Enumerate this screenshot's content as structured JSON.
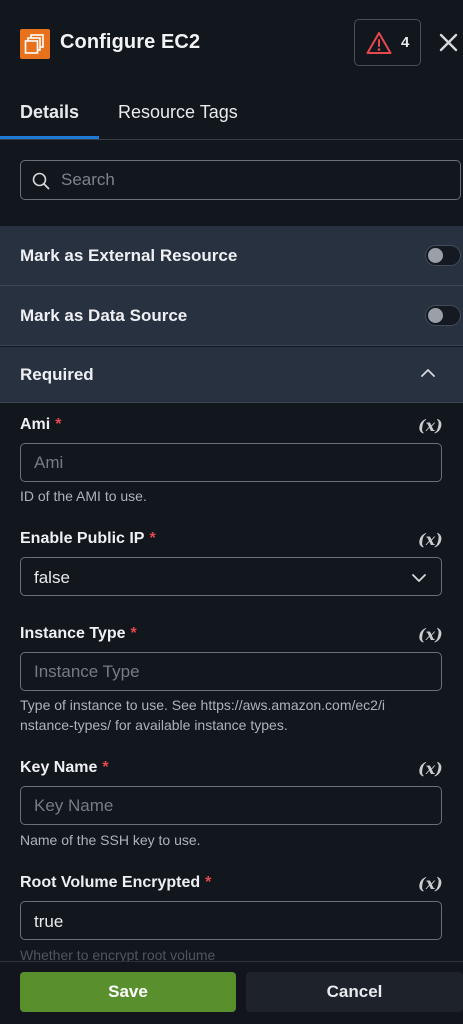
{
  "header": {
    "title": "Configure EC2",
    "app_icon": "aws-ec2-icon",
    "alert_count": "4",
    "alert_icon": "warning-triangle-icon",
    "close_icon": "close-icon",
    "accent_color": "#e8711c"
  },
  "tabs": [
    {
      "label": "Details",
      "active": true
    },
    {
      "label": "Resource Tags",
      "active": false
    }
  ],
  "search": {
    "placeholder": "Search",
    "value": ""
  },
  "toggles": [
    {
      "label": "Mark as External Resource",
      "on": false
    },
    {
      "label": "Mark as Data Source",
      "on": false
    }
  ],
  "section": {
    "label": "Required",
    "expanded": true
  },
  "variable_button": "(x)",
  "required_marker": "*",
  "fields": {
    "ami": {
      "label": "Ami",
      "placeholder": "Ami",
      "value": "",
      "help": "ID of the AMI to use."
    },
    "enable_public_ip": {
      "label": "Enable Public IP",
      "value": "false"
    },
    "instance_type": {
      "label": "Instance Type",
      "placeholder": "Instance Type",
      "value": "",
      "help_line1": "Type of instance to use. See https://aws.amazon.com/ec2/i",
      "help_line2": "nstance-types/ for available instance types."
    },
    "key_name": {
      "label": "Key Name",
      "placeholder": "Key Name",
      "value": "",
      "help": "Name of the SSH key to use."
    },
    "root_volume_encrypted": {
      "label": "Root Volume Encrypted",
      "value": "true",
      "help": "Whether to encrypt root volume"
    }
  },
  "footer": {
    "save_label": "Save",
    "cancel_label": "Cancel",
    "save_color": "#5a8f2d"
  }
}
